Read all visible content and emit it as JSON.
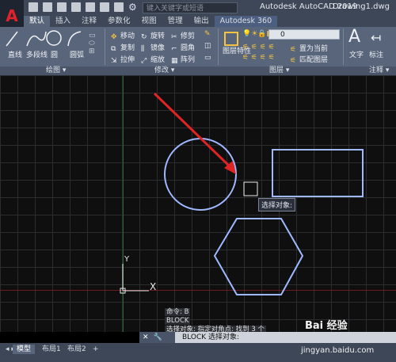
{
  "title_bar": {
    "logo": "A",
    "search_placeholder": "键入关键字或短语",
    "app_title": "Autodesk AutoCAD 2019",
    "file_name": "Drawing1.dwg"
  },
  "tabs": [
    "默认",
    "插入",
    "注释",
    "参数化",
    "视图",
    "管理",
    "输出",
    "Autodesk 360"
  ],
  "ribbon": {
    "draw_tools": {
      "line": "直线",
      "polyline": "多段线",
      "circle": "圆",
      "arc": "圆弧"
    },
    "modify_tools": {
      "move": "移动",
      "rotate": "旋转",
      "trim": "修剪",
      "copy": "复制",
      "mirror": "镜像",
      "fillet": "圆角",
      "stretch": "拉伸",
      "scale": "缩放",
      "array": "阵列"
    },
    "layer_tools": {
      "properties": "图层特性",
      "set_current": "置为当前",
      "match_layer": "匹配图层",
      "current_layer": "0"
    },
    "annotation_tools": {
      "text": "文字",
      "dimension": "标注"
    },
    "panel_labels": {
      "draw": "绘图",
      "modify": "修改",
      "layers": "图层",
      "annotation": "注释"
    }
  },
  "canvas": {
    "tooltip": "选择对象:",
    "ucs_y": "Y",
    "ucs_x": "X",
    "shape_color": "#9fb8ff",
    "arrow_color": "#e02424"
  },
  "command_history": [
    "命令: B",
    "BLOCK",
    "选择对象: 指定对角点: 找到 3 个"
  ],
  "command_line": {
    "text": "BLOCK 选择对象:",
    "close": "✕",
    "wrench": "🔧"
  },
  "layout_tabs": [
    "模型",
    "布局1",
    "布局2",
    "+"
  ],
  "watermark": {
    "brand": "Bai 经验",
    "url": "jingyan.baidu.com"
  }
}
